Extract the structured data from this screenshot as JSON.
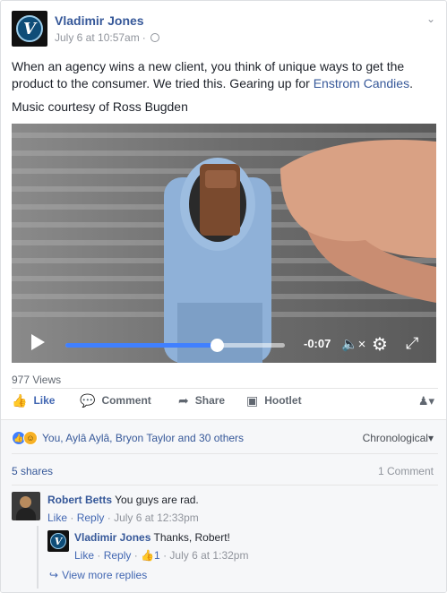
{
  "post": {
    "author": "Vladimir Jones",
    "avatar_letter": "V",
    "timestamp": "July 6 at 10:57am",
    "audience_separator": "·",
    "text_before_link": "When an agency wins a new client, you think of unique ways to get the product to the consumer. We tried this. Gearing up for ",
    "link_text": "Enstrom Candies",
    "text_after_link": ".",
    "music_credit": "Music courtesy of Ross Bugden"
  },
  "video": {
    "time_remaining": "-0:07",
    "progress": 0.69,
    "play_icon": "play-icon",
    "mute_icon": "mute-icon",
    "settings_icon": "gear-icon",
    "fullscreen_icon": "fullscreen-icon"
  },
  "views": "977 Views",
  "actions": {
    "like": "Like",
    "comment": "Comment",
    "share": "Share",
    "hootlet": "Hootlet"
  },
  "reactions": {
    "summary": "You, Aylâ Aylâ, Bryon Taylor and 30 others",
    "sort": "Chronological"
  },
  "counts": {
    "shares": "5 shares",
    "comments": "1 Comment"
  },
  "comments": [
    {
      "name": "Robert Betts",
      "text": "You guys are rad.",
      "like": "Like",
      "reply": "Reply",
      "sep": "·",
      "time": "July 6 at 12:33pm"
    }
  ],
  "reply": {
    "name": "Vladimir Jones",
    "avatar_letter": "V",
    "text": "Thanks, Robert!",
    "like": "Like",
    "reply": "Reply",
    "sep": "·",
    "like_count": "1",
    "time": "July 6 at 1:32pm"
  },
  "more_replies": "View more replies",
  "colors": {
    "link": "#365899",
    "accent": "#4267b2",
    "progress": "#4080ff"
  }
}
